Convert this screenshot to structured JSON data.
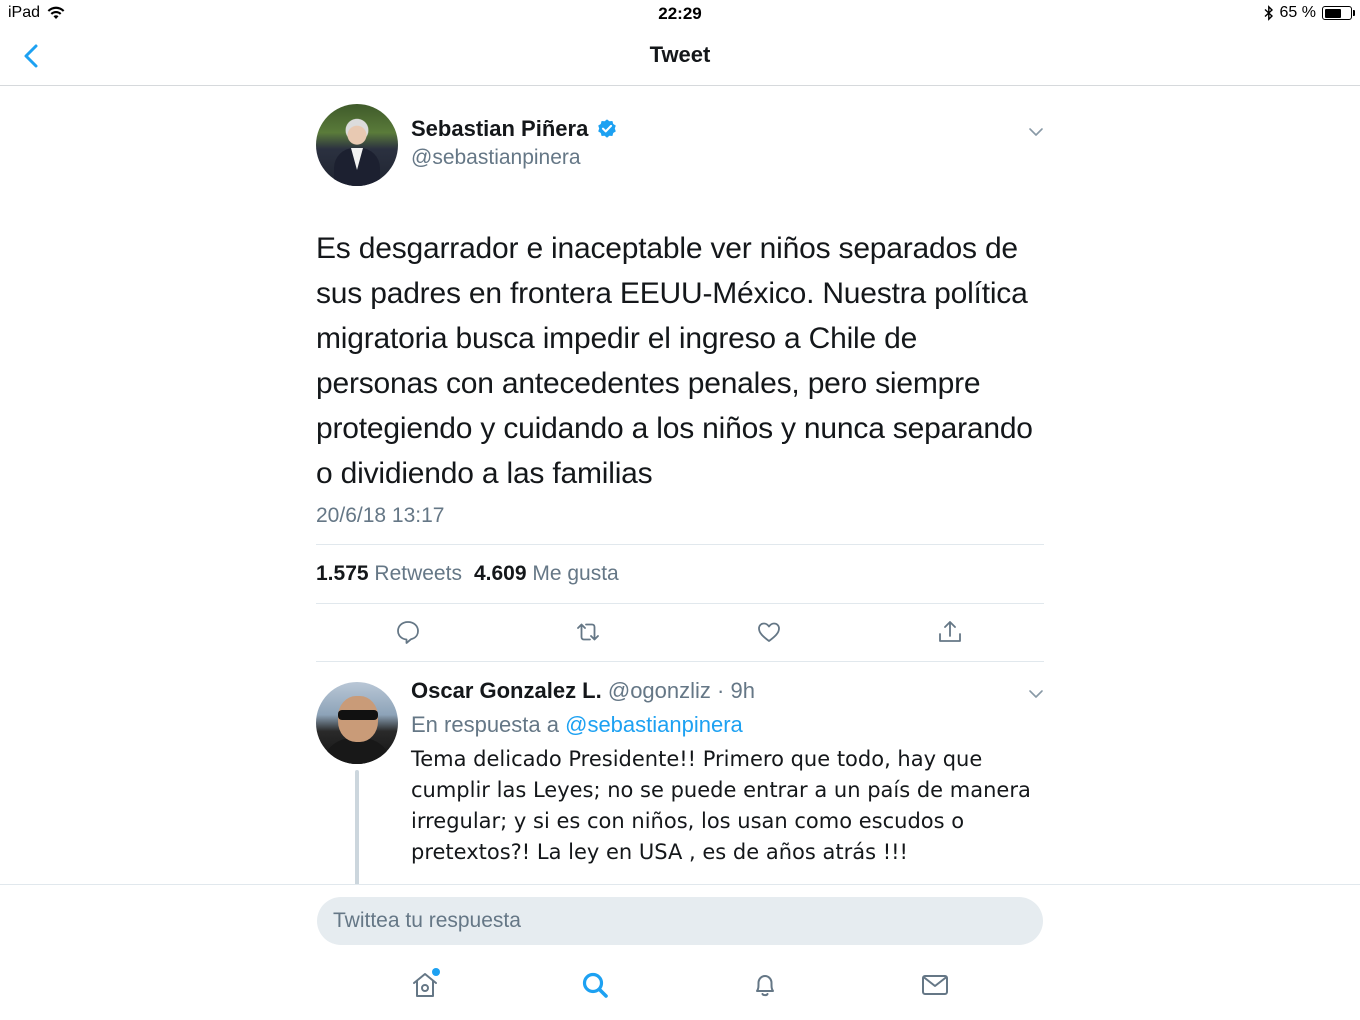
{
  "status_bar": {
    "device": "iPad",
    "time": "22:29",
    "battery": "65 %",
    "battery_level": 0.65
  },
  "nav": {
    "title": "Tweet"
  },
  "tweet": {
    "display_name": "Sebastian Piñera",
    "handle": "@sebastianpinera",
    "text": "Es desgarrador e inaceptable ver niños separados de sus padres en frontera EEUU-México. Nuestra política migratoria busca impedir el ingreso a Chile de personas con antecedentes penales, pero siempre protegiendo y cuidando a los niños y nunca separando o dividiendo a las familias",
    "timestamp": "20/6/18 13:17",
    "retweets_count": "1.575",
    "retweets_label": "Retweets",
    "likes_count": "4.609",
    "likes_label": "Me gusta"
  },
  "reply": {
    "display_name": "Oscar Gonzalez L.",
    "meta": "@ogonzliz · 9h",
    "in_reply_prefix": "En respuesta a",
    "in_reply_handle": "@sebastianpinera",
    "text": "Tema delicado Presidente!! Primero que todo, hay que cumplir las Leyes; no se puede entrar a un país de manera irregular; y si es con niños, los usan como escudos o pretextos?! La ley en USA , es de años atrás !!!"
  },
  "composer": {
    "placeholder": "Twittea tu respuesta"
  },
  "colors": {
    "accent": "#1da1f2",
    "secondary_text": "#657786",
    "divider": "#e1e8ed"
  }
}
